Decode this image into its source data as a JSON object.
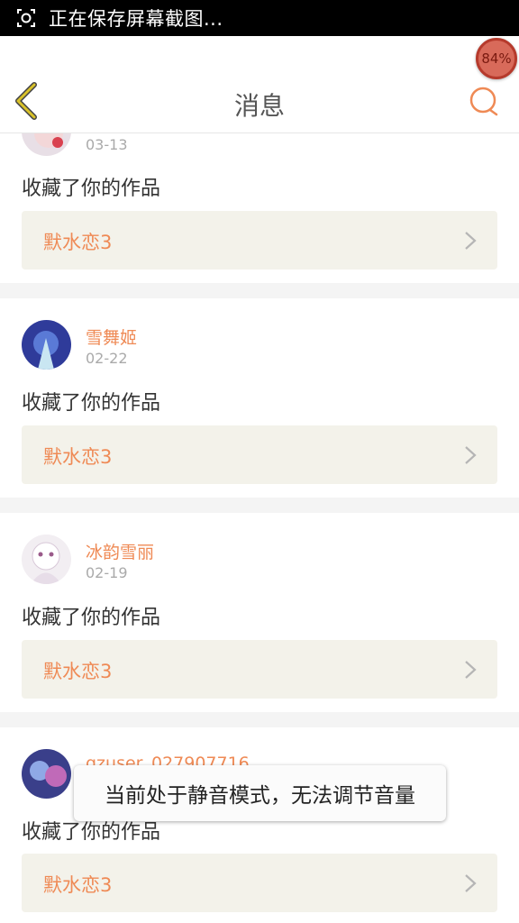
{
  "status_bar": {
    "text": "正在保存屏幕截图..."
  },
  "header": {
    "title": "消息"
  },
  "float_badge": {
    "label": "84%"
  },
  "messages": [
    {
      "user": "",
      "date": "03-13",
      "action": "收藏了你的作品",
      "work": "默水恋3"
    },
    {
      "user": "雪舞姬",
      "date": "02-22",
      "action": "收藏了你的作品",
      "work": "默水恋3"
    },
    {
      "user": "冰韵雪丽",
      "date": "02-19",
      "action": "收藏了你的作品",
      "work": "默水恋3"
    },
    {
      "user": "qzuser_027907716",
      "date": "",
      "action": "收藏了你的作品",
      "work": "默水恋3"
    }
  ],
  "toast": {
    "text": "当前处于静音模式，无法调节音量"
  },
  "colors": {
    "accent": "#ef8a55",
    "back_arrow": "#c9b020",
    "work_bg": "#f3f2ea"
  }
}
